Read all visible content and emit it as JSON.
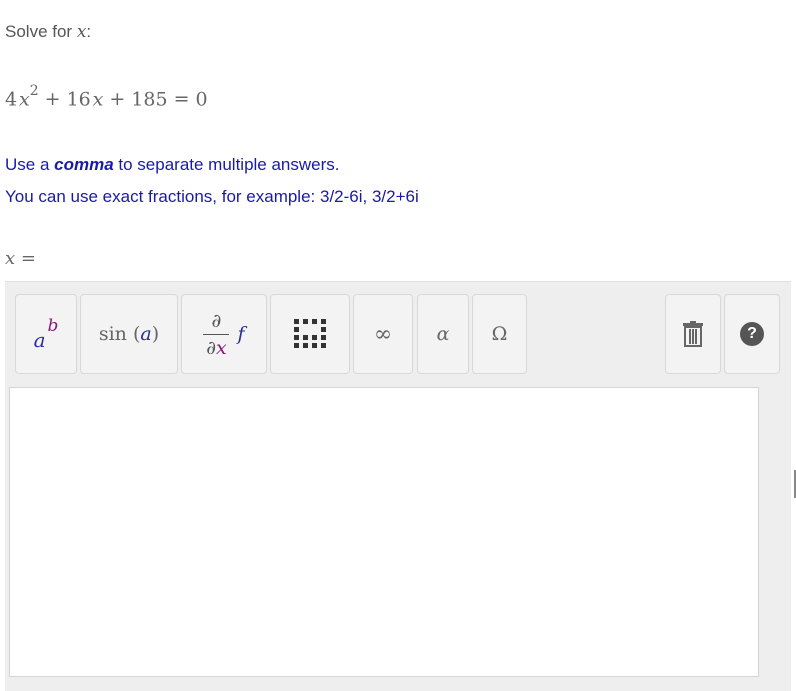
{
  "prompt": {
    "text": "Solve for ",
    "variable": "x",
    "suffix": ":"
  },
  "equation": {
    "coef_a": "4",
    "var": "x",
    "exponent": "2",
    "plus1": "+",
    "coef_b": "16",
    "var2": "x",
    "plus2": "+",
    "constant": "185",
    "equals": "=",
    "rhs": "0"
  },
  "hints": {
    "line1_prefix": "Use a ",
    "line1_bold": "comma",
    "line1_suffix": " to separate multiple answers.",
    "line2": "You can use exact fractions, for example: 3/2-6i, 3/2+6i"
  },
  "answer_label": {
    "var": "x",
    "equals": "="
  },
  "toolbar": {
    "power": {
      "base": "a",
      "exponent": "b"
    },
    "trig": {
      "fn": "sin",
      "open": "(",
      "arg": "a",
      "close": ")"
    },
    "calculus": {
      "numerator": "∂",
      "denominator_d": "∂",
      "denominator_x": "x",
      "fn": "f"
    },
    "infinity": "∞",
    "alpha": "α",
    "omega": "Ω",
    "help": "?"
  },
  "editor": {
    "value": ""
  },
  "colors": {
    "hint_text": "#1a1aa6",
    "panel_bg": "#eeeeee",
    "button_bg": "#f3f3f3"
  }
}
